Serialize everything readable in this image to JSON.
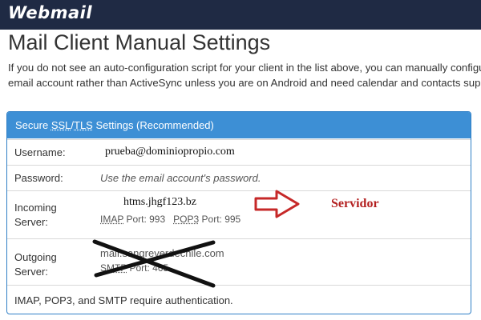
{
  "header": {
    "logo_text": "Webmail"
  },
  "title": "Mail Client Manual Settings",
  "intro": {
    "line1": "If you do not see an auto-configuration script for your client in the list above, you can manually configu",
    "line2": "email account rather than ActiveSync unless you are on Android and need calendar and contacts supp"
  },
  "panel": {
    "header_prefix": "Secure ",
    "header_ssl": "SSL",
    "header_sep": "/",
    "header_tls": "TLS",
    "header_suffix": " Settings (Recommended)",
    "username_label": "Username:",
    "username_value": "prueba@dominiopropio.com",
    "password_label": "Password:",
    "password_value": "Use the email account's password.",
    "incoming_label_1": "Incoming",
    "incoming_label_2": "Server:",
    "incoming_host": "htms.jhgf123.bz",
    "imap_label": "IMAP",
    "imap_port_text": " Port: 993",
    "pop3_label": "POP3",
    "pop3_port_text": " Port: 995",
    "outgoing_label_1": "Outgoing",
    "outgoing_label_2": "Server:",
    "outgoing_host": "mail.sangreverdechile.com",
    "smtp_label": "SMTP",
    "smtp_port_text": " Port: 465",
    "footer_note": "IMAP, POP3, and SMTP require authentication."
  },
  "annotation": {
    "servidor_label": "Servidor",
    "arrow_color": "#c62828",
    "cross_color": "#111111"
  },
  "colors": {
    "topbar": "#1f2a44",
    "panel_header": "#3d8fd5",
    "panel_border": "#2f7fc6"
  }
}
